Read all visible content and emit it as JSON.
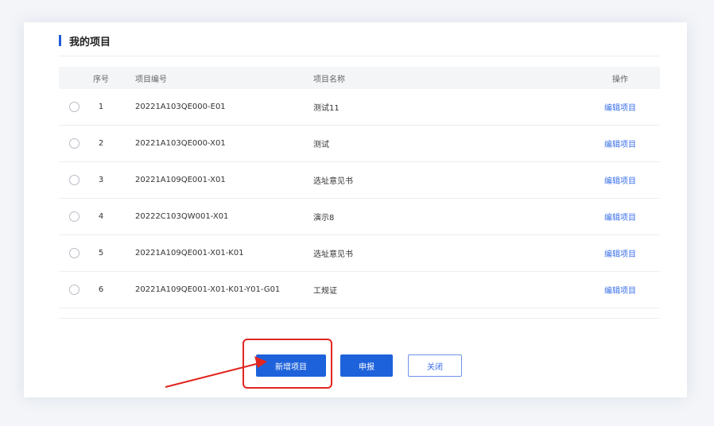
{
  "header": {
    "title": "我的项目"
  },
  "table": {
    "columns": {
      "no": "序号",
      "code": "项目编号",
      "name": "项目名称",
      "op": "操作"
    },
    "rows": [
      {
        "no": "1",
        "code": "20221A103QE000-E01",
        "name": "测试11",
        "op": "编辑项目"
      },
      {
        "no": "2",
        "code": "20221A103QE000-X01",
        "name": "测试",
        "op": "编辑项目"
      },
      {
        "no": "3",
        "code": "20221A109QE001-X01",
        "name": "选址意见书",
        "op": "编辑项目"
      },
      {
        "no": "4",
        "code": "20222C103QW001-X01",
        "name": "演示8",
        "op": "编辑项目"
      },
      {
        "no": "5",
        "code": "20221A109QE001-X01-K01",
        "name": "选址意见书",
        "op": "编辑项目"
      },
      {
        "no": "6",
        "code": "20221A109QE001-X01-K01-Y01-G01",
        "name": "工规证",
        "op": "编辑项目"
      }
    ]
  },
  "actions": {
    "add_label": "新增项目",
    "submit_label": "申报",
    "close_label": "关闭"
  },
  "colors": {
    "primary": "#1e62db",
    "link": "#3a6fe8",
    "highlight": "#e0261f"
  }
}
